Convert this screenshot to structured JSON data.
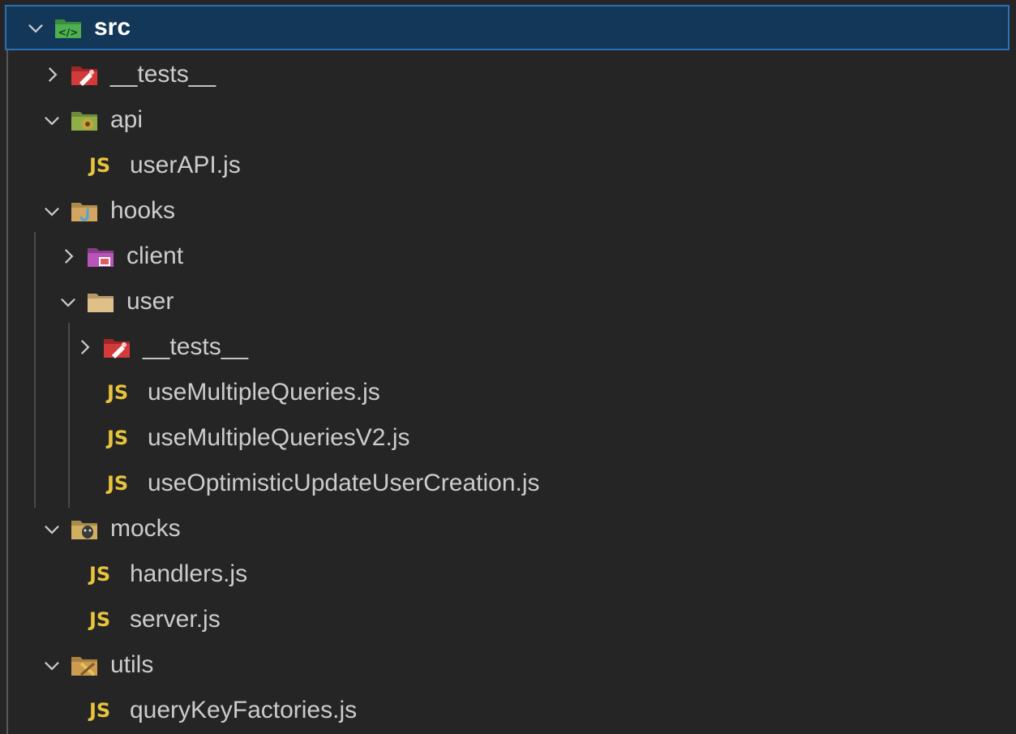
{
  "explorer": {
    "root": {
      "label": "src",
      "expanded": true,
      "icon": "folder-src-icon"
    },
    "items": [
      {
        "label": "__tests__",
        "type": "folder",
        "expanded": false,
        "icon": "folder-test-icon"
      },
      {
        "label": "api",
        "type": "folder",
        "expanded": true,
        "icon": "folder-api-icon"
      },
      {
        "label": "userAPI.js",
        "type": "file",
        "badge": "JS"
      },
      {
        "label": "hooks",
        "type": "folder",
        "expanded": true,
        "icon": "folder-hooks-icon"
      },
      {
        "label": "client",
        "type": "folder",
        "expanded": false,
        "icon": "folder-client-icon"
      },
      {
        "label": "user",
        "type": "folder",
        "expanded": true,
        "icon": "folder-user-icon"
      },
      {
        "label": "__tests__",
        "type": "folder",
        "expanded": false,
        "icon": "folder-test-icon"
      },
      {
        "label": "useMultipleQueries.js",
        "type": "file",
        "badge": "JS"
      },
      {
        "label": "useMultipleQueriesV2.js",
        "type": "file",
        "badge": "JS"
      },
      {
        "label": "useOptimisticUpdateUserCreation.js",
        "type": "file",
        "badge": "JS"
      },
      {
        "label": "mocks",
        "type": "folder",
        "expanded": true,
        "icon": "folder-mocks-icon"
      },
      {
        "label": "handlers.js",
        "type": "file",
        "badge": "JS"
      },
      {
        "label": "server.js",
        "type": "file",
        "badge": "JS"
      },
      {
        "label": "utils",
        "type": "folder",
        "expanded": true,
        "icon": "folder-utils-icon"
      },
      {
        "label": "queryKeyFactories.js",
        "type": "file",
        "badge": "JS"
      }
    ]
  },
  "colors": {
    "background": "#252526",
    "selection": "#133758",
    "selection_border": "#2d6fb4",
    "js_badge": "#e8c33c"
  }
}
